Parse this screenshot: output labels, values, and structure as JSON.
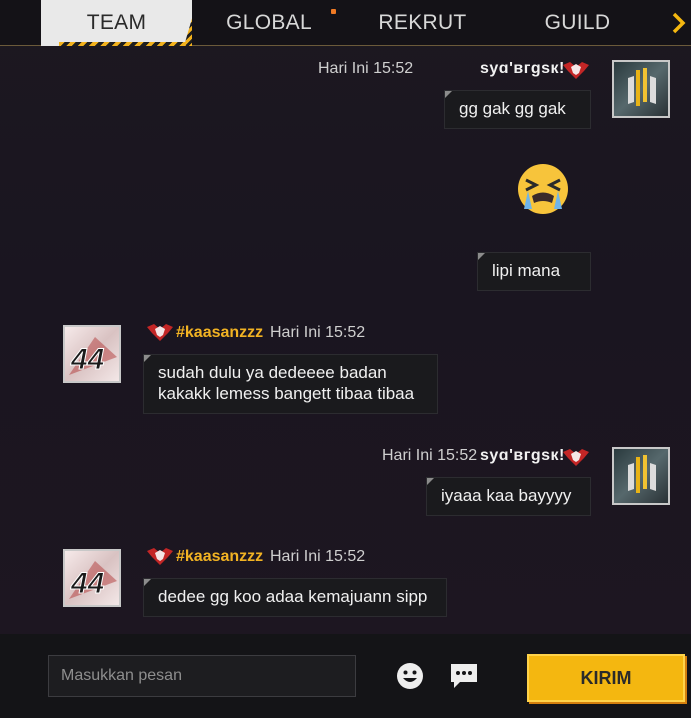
{
  "tabs": [
    {
      "label": "TEAM",
      "active": true
    },
    {
      "label": "GLOBAL",
      "active": false
    },
    {
      "label": "REKRUT",
      "active": false
    },
    {
      "label": "GUILD",
      "active": false
    }
  ],
  "tab_next_icon": "chevron-right-icon",
  "colors": {
    "accent": "#f4b710",
    "tag": "#f2b323",
    "notification": "#f07a24"
  },
  "messages": [
    {
      "side": "right",
      "time": "Hari Ini 15:52",
      "sender": "syɑ'вгgsк!",
      "text": "gg gak gg gak",
      "avatar": "gold-sword-avatar"
    },
    {
      "side": "right",
      "emoji": "crying-emoji"
    },
    {
      "side": "right",
      "text": "lipi mana"
    },
    {
      "side": "left",
      "sender": "#kaasanzzz",
      "time": "Hari Ini 15:52",
      "text_line1": "sudah dulu ya dedeeee badan",
      "text_line2": "kakakk lemess bangett tibaa tibaa",
      "avatar": "number-44-avatar"
    },
    {
      "side": "right",
      "time": "Hari Ini 15:52",
      "sender": "syɑ'вгgsк!",
      "text": "iyaaa kaa bayyyy",
      "avatar": "gold-sword-avatar"
    },
    {
      "side": "left",
      "sender": "#kaasanzzz",
      "time": "Hari Ini 15:52",
      "text": "dedee gg koo adaa kemajuann sipp",
      "avatar": "number-44-avatar"
    }
  ],
  "input": {
    "placeholder": "Masukkan pesan",
    "value": ""
  },
  "send_label": "KIRIM"
}
